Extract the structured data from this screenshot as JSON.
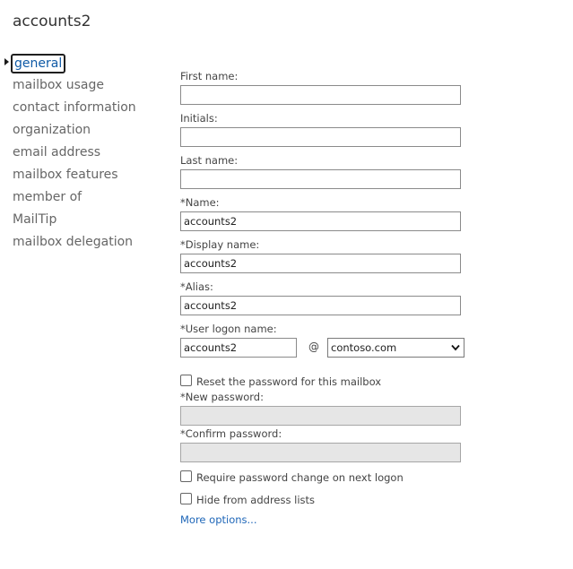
{
  "page": {
    "title": "accounts2"
  },
  "nav": {
    "items": [
      {
        "label": "general",
        "selected": true
      },
      {
        "label": "mailbox usage"
      },
      {
        "label": "contact information"
      },
      {
        "label": "organization"
      },
      {
        "label": "email address"
      },
      {
        "label": "mailbox features"
      },
      {
        "label": "member of"
      },
      {
        "label": "MailTip"
      },
      {
        "label": "mailbox delegation"
      }
    ]
  },
  "form": {
    "first_name": {
      "label": "First name:",
      "value": ""
    },
    "initials": {
      "label": "Initials:",
      "value": ""
    },
    "last_name": {
      "label": "Last name:",
      "value": ""
    },
    "name": {
      "label": "*Name:",
      "value": "accounts2"
    },
    "display_name": {
      "label": "*Display name:",
      "value": "accounts2"
    },
    "alias": {
      "label": "*Alias:",
      "value": "accounts2"
    },
    "user_logon": {
      "label": "*User logon name:",
      "value": "accounts2",
      "at": "@",
      "domain": "contoso.com"
    },
    "reset_password": {
      "label": "Reset the password for this mailbox",
      "checked": false
    },
    "new_password": {
      "label": "*New password:",
      "value": "",
      "disabled": true
    },
    "confirm_password": {
      "label": "*Confirm password:",
      "value": "",
      "disabled": true
    },
    "require_change": {
      "label": "Require password change on next logon",
      "checked": false
    },
    "hide_from_lists": {
      "label": "Hide from address lists",
      "checked": false
    },
    "more_options": "More options..."
  },
  "colors": {
    "link": "#1e66b8",
    "nav_selected": "#0f5aa6",
    "nav_text": "#666666",
    "disabled_field": "#e6e6e6"
  },
  "icons": {
    "nav_selection": "triangle-right-icon",
    "select": "chevron-down-icon"
  }
}
